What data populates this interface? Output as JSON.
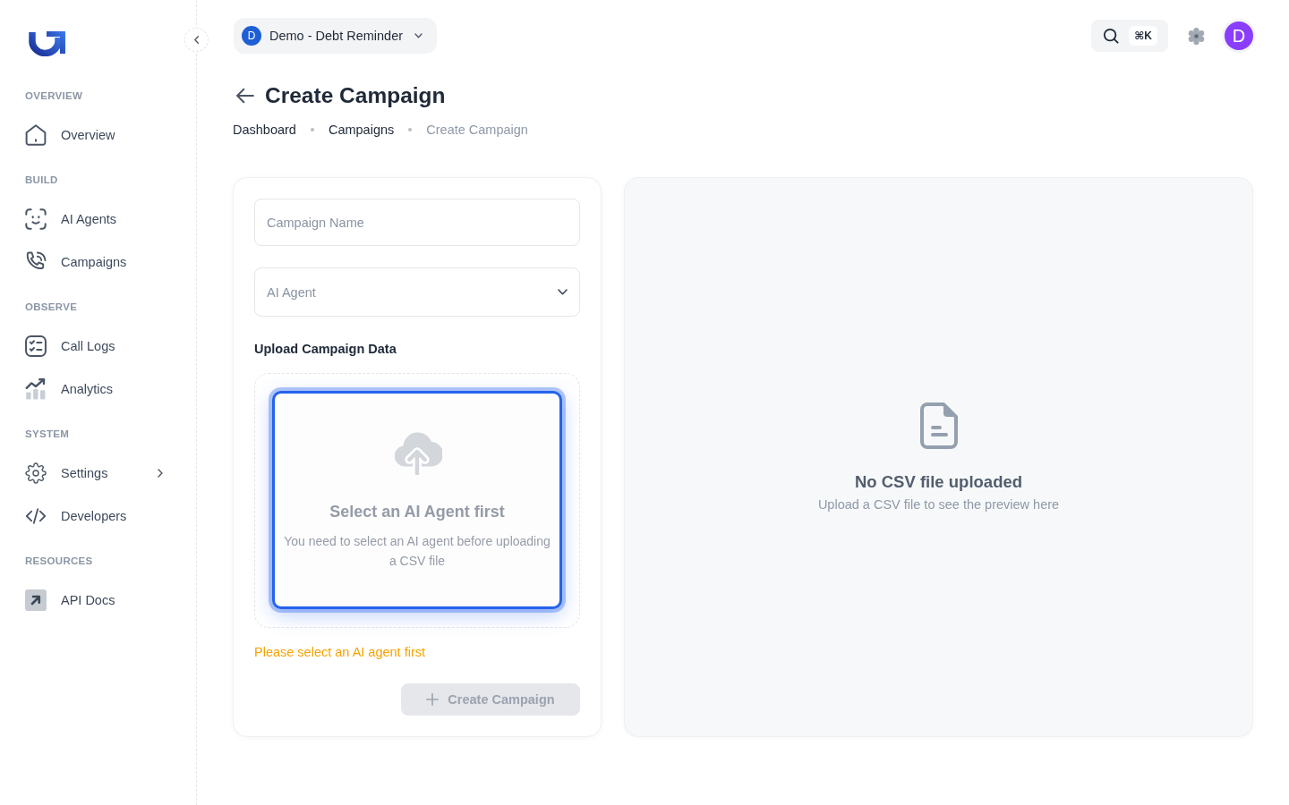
{
  "sidebar": {
    "sections": [
      {
        "heading": "OVERVIEW",
        "items": [
          {
            "label": "Overview",
            "selected": false,
            "submenu": false
          }
        ]
      },
      {
        "heading": "BUILD",
        "items": [
          {
            "label": "AI Agents",
            "selected": false,
            "submenu": false
          },
          {
            "label": "Campaigns",
            "selected": false,
            "submenu": false
          }
        ]
      },
      {
        "heading": "OBSERVE",
        "items": [
          {
            "label": "Call Logs",
            "selected": false,
            "submenu": false
          },
          {
            "label": "Analytics",
            "selected": false,
            "submenu": false
          }
        ]
      },
      {
        "heading": "SYSTEM",
        "items": [
          {
            "label": "Settings",
            "selected": false,
            "submenu": true
          },
          {
            "label": "Developers",
            "selected": false,
            "submenu": false
          }
        ]
      },
      {
        "heading": "RESOURCES",
        "items": [
          {
            "label": "API Docs",
            "selected": false,
            "submenu": false
          }
        ]
      }
    ]
  },
  "topbar": {
    "workspace": {
      "initial": "D",
      "name": "Demo - Debt Reminder"
    },
    "search": {
      "shortcut": "⌘K"
    },
    "user": {
      "initial": "D"
    }
  },
  "page": {
    "title": "Create Campaign",
    "breadcrumbs": [
      {
        "label": "Dashboard",
        "current": false
      },
      {
        "label": "Campaigns",
        "current": false
      },
      {
        "label": "Create Campaign",
        "current": true
      }
    ]
  },
  "form": {
    "campaign_name": {
      "placeholder": "Campaign Name"
    },
    "ai_agent": {
      "placeholder": "AI Agent"
    },
    "upload": {
      "label": "Upload Campaign Data",
      "title": "Select an AI Agent first",
      "description": "You need to select an AI agent before uploading a CSV file",
      "disabled": true,
      "focused": true
    },
    "warning": "Please select an AI agent first",
    "submit": {
      "label": "Create Campaign",
      "disabled": true
    }
  },
  "preview": {
    "title": "No CSV file uploaded",
    "description": "Upload a CSV file to see the preview here"
  }
}
